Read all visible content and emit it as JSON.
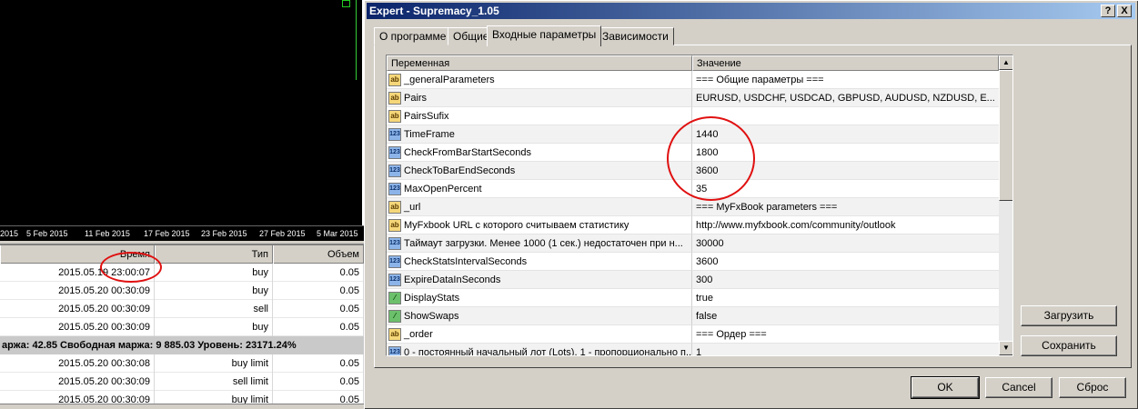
{
  "chart": {
    "dates": [
      "2015",
      "5 Feb 2015",
      "11 Feb 2015",
      "17 Feb 2015",
      "23 Feb 2015",
      "27 Feb 2015",
      "5 Mar 2015"
    ]
  },
  "terminal": {
    "headers": {
      "time": "Время",
      "type": "Тип",
      "volume": "Объем"
    },
    "rows_top": [
      {
        "time": "2015.05.19 23:00:07",
        "type": "buy",
        "volume": "0.05"
      },
      {
        "time": "2015.05.20 00:30:09",
        "type": "buy",
        "volume": "0.05"
      },
      {
        "time": "2015.05.20 00:30:09",
        "type": "sell",
        "volume": "0.05"
      },
      {
        "time": "2015.05.20 00:30:09",
        "type": "buy",
        "volume": "0.05"
      }
    ],
    "summary": "аржа: 42.85  Свободная маржа: 9 885.03  Уровень: 23171.24%",
    "rows_bottom": [
      {
        "time": "2015.05.20 00:30:08",
        "type": "buy limit",
        "volume": "0.05"
      },
      {
        "time": "2015.05.20 00:30:09",
        "type": "sell limit",
        "volume": "0.05"
      },
      {
        "time": "2015.05.20 00:30:09",
        "type": "buy limit",
        "volume": "0.05"
      }
    ]
  },
  "dialog": {
    "title": "Expert - Supremacy_1.05",
    "help_button": "?",
    "close_button": "X",
    "tabs": [
      "О программе",
      "Общие",
      "Входные параметры",
      "Зависимости"
    ],
    "active_tab": "Входные параметры",
    "grid": {
      "col_variable": "Переменная",
      "col_value": "Значение",
      "rows": [
        {
          "icon": "ab",
          "name": "_generalParameters",
          "value": "=== Общие параметры ==="
        },
        {
          "icon": "ab",
          "name": "Pairs",
          "value": "EURUSD, USDCHF, USDCAD, GBPUSD, AUDUSD, NZDUSD, E..."
        },
        {
          "icon": "ab",
          "name": "PairsSufix",
          "value": ""
        },
        {
          "icon": "123",
          "name": "TimeFrame",
          "value": "1440"
        },
        {
          "icon": "123",
          "name": "CheckFromBarStartSeconds",
          "value": "1800"
        },
        {
          "icon": "123",
          "name": "CheckToBarEndSeconds",
          "value": "3600"
        },
        {
          "icon": "123",
          "name": "MaxOpenPercent",
          "value": "35"
        },
        {
          "icon": "ab",
          "name": "_url",
          "value": "=== MyFxBook parameters ==="
        },
        {
          "icon": "ab",
          "name": "MyFxbook URL с которого считываем статистику",
          "value": "http://www.myfxbook.com/community/outlook"
        },
        {
          "icon": "123",
          "name": "Таймаут загрузки. Менее 1000 (1 сек.) недостаточен при н...",
          "value": "30000"
        },
        {
          "icon": "123",
          "name": "CheckStatsIntervalSeconds",
          "value": "3600"
        },
        {
          "icon": "123",
          "name": "ExpireDataInSeconds",
          "value": "300"
        },
        {
          "icon": "bool",
          "name": "DisplayStats",
          "value": "true"
        },
        {
          "icon": "bool",
          "name": "ShowSwaps",
          "value": "false"
        },
        {
          "icon": "ab",
          "name": "_order",
          "value": "=== Ордер ==="
        },
        {
          "icon": "123",
          "name": "0 - постоянный начальный лот (Lots), 1 - пропорционально п...",
          "value": "1"
        }
      ]
    },
    "buttons": {
      "load": "Загрузить",
      "save": "Сохранить",
      "ok": "OK",
      "cancel": "Cancel",
      "reset": "Сброс"
    }
  }
}
